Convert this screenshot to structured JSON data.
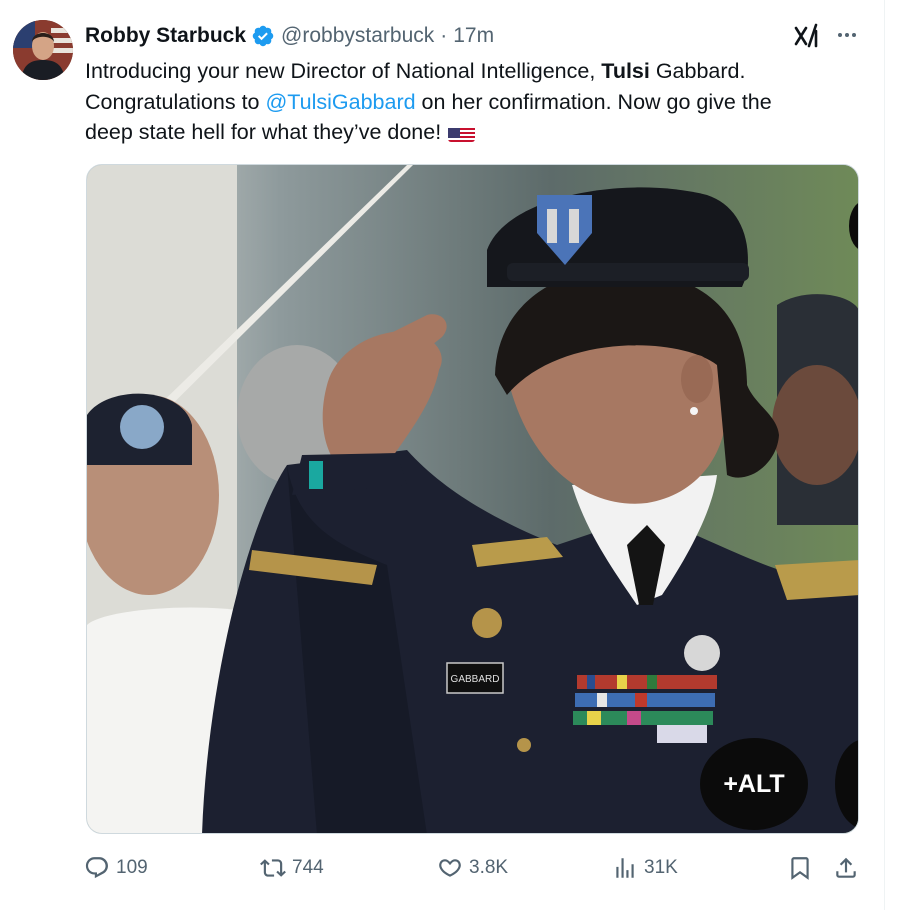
{
  "tweet": {
    "author_name": "Robby Starbuck",
    "handle": "@robbystarbuck",
    "separator": "·",
    "time": "17m",
    "text": {
      "line1_pre": "Introducing your new Director of National Intelligence, ",
      "line1_bold": "Tulsi",
      "line1_post": " Gabbard.",
      "line2_pre": "Congratulations to ",
      "line2_mention": "@TulsiGabbard",
      "line2_post": " on her confirmation. Now go give the",
      "line3": "deep state hell for what they’ve done!"
    },
    "flag_icon": "us-flag-emoji",
    "media": {
      "alt_label": "+ALT",
      "name_tag": "GABBARD"
    }
  },
  "actions": {
    "replies": "109",
    "reposts": "744",
    "likes": "3.8K",
    "views": "31K"
  },
  "icons": [
    "verified-badge-icon",
    "grok-icon",
    "more-icon",
    "reply-icon",
    "repost-icon",
    "like-icon",
    "views-icon",
    "bookmark-icon",
    "share-icon"
  ],
  "colors": {
    "accent": "#1d9bf0",
    "text": "#0f1419",
    "secondary": "#536471"
  }
}
